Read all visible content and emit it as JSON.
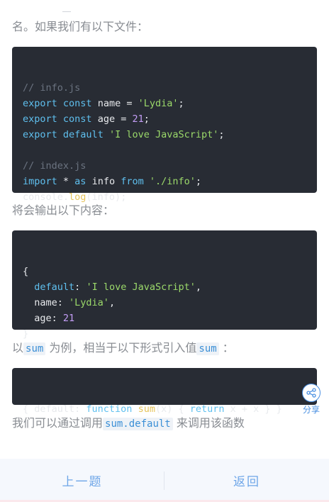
{
  "intro_text": "名。如果我们有以下文件：",
  "code1": {
    "lines": [
      [
        [
          "cm",
          "// info.js"
        ]
      ],
      [
        [
          "kw",
          "export"
        ],
        [
          "txt",
          " "
        ],
        [
          "kw",
          "const"
        ],
        [
          "txt",
          " name = "
        ],
        [
          "str",
          "'Lydia'"
        ],
        [
          "txt",
          ";"
        ]
      ],
      [
        [
          "kw",
          "export"
        ],
        [
          "txt",
          " "
        ],
        [
          "kw",
          "const"
        ],
        [
          "txt",
          " age = "
        ],
        [
          "num",
          "21"
        ],
        [
          "txt",
          ";"
        ]
      ],
      [
        [
          "kw",
          "export"
        ],
        [
          "txt",
          " "
        ],
        [
          "kw",
          "default"
        ],
        [
          "txt",
          " "
        ],
        [
          "str",
          "'I love JavaScript'"
        ],
        [
          "txt",
          ";"
        ]
      ],
      [],
      [
        [
          "cm",
          "// index.js"
        ]
      ],
      [
        [
          "kw",
          "import"
        ],
        [
          "txt",
          " * "
        ],
        [
          "kw",
          "as"
        ],
        [
          "txt",
          " info "
        ],
        [
          "kw",
          "from"
        ],
        [
          "txt",
          " "
        ],
        [
          "str",
          "'./info'"
        ],
        [
          "txt",
          ";"
        ]
      ],
      [
        [
          "txt",
          "console."
        ],
        [
          "fn",
          "log"
        ],
        [
          "txt",
          "(info);"
        ]
      ]
    ]
  },
  "output_intro": "将会输出以下内容：",
  "code2": {
    "lines": [
      [
        [
          "txt",
          "{"
        ]
      ],
      [
        [
          "txt",
          "  "
        ],
        [
          "prop",
          "default"
        ],
        [
          "txt",
          ": "
        ],
        [
          "str",
          "'I love JavaScript'"
        ],
        [
          "txt",
          ","
        ]
      ],
      [
        [
          "txt",
          "  name: "
        ],
        [
          "str",
          "'Lydia'"
        ],
        [
          "txt",
          ","
        ]
      ],
      [
        [
          "txt",
          "  age: "
        ],
        [
          "num",
          "21"
        ]
      ],
      [
        [
          "txt",
          "}"
        ]
      ]
    ]
  },
  "example": {
    "prefix": "以",
    "code_a": "sum",
    "middle": " 为例，相当于以下形式引入值",
    "code_b": "sum",
    "suffix": " ："
  },
  "code3": {
    "lines": [
      [
        [
          "txt",
          "{ default: "
        ],
        [
          "kw",
          "function"
        ],
        [
          "txt",
          " "
        ],
        [
          "fn",
          "sum"
        ],
        [
          "txt",
          "(x) { "
        ],
        [
          "kw",
          "return"
        ],
        [
          "txt",
          " x + x } }"
        ]
      ]
    ]
  },
  "final": {
    "prefix": "我们可以通过调用",
    "code": "sum.default",
    "suffix": " 来调用该函数"
  },
  "share": {
    "label": "分享",
    "icon": "share-icon"
  },
  "nav": {
    "prev_label": "上一题",
    "back_label": "返回"
  },
  "colors": {
    "accent": "#4a90e2",
    "code_bg": "#282c34",
    "bottom_bar": "#f5f8fd"
  }
}
